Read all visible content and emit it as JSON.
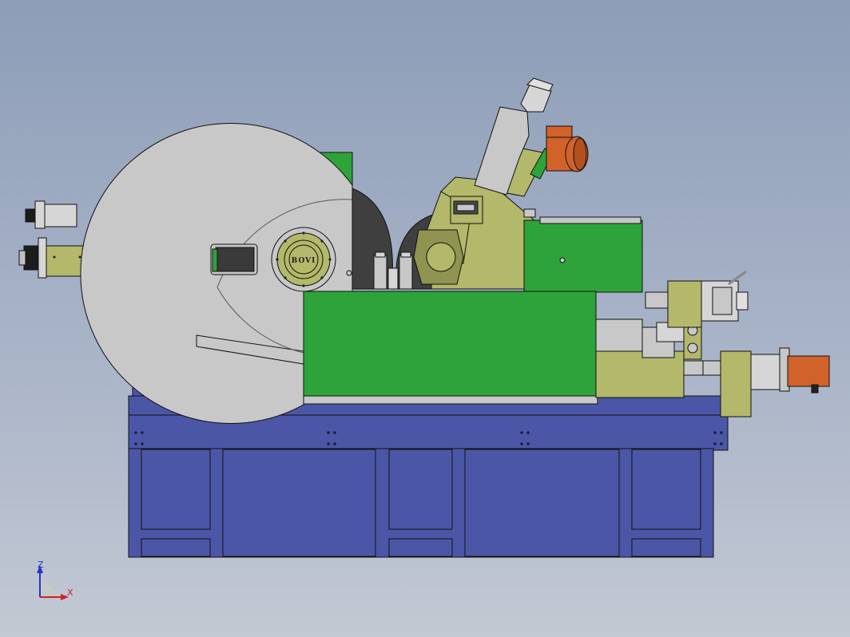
{
  "viewport": {
    "background_top": "#8d9db8",
    "background_bottom": "#c3c8d3"
  },
  "colors": {
    "base": "#4b56a6",
    "base_edge": "#1d2460",
    "frame_green": "#2ea33a",
    "olive": "#b4b86a",
    "olive_dark": "#8f9450",
    "wheel_grey": "#c8c8c8",
    "dark_wheel": "#3f3f3f",
    "motor_orange": "#d0622a",
    "steel": "#d6d6d6",
    "line": "#111111"
  },
  "wheel_logo": {
    "text": "BOVI",
    "icon": "grinding-wheel-logo-icon"
  },
  "triad": {
    "z_label": "Z",
    "x_label": "X",
    "z_color": "#2233cc",
    "x_color": "#cc2222"
  }
}
